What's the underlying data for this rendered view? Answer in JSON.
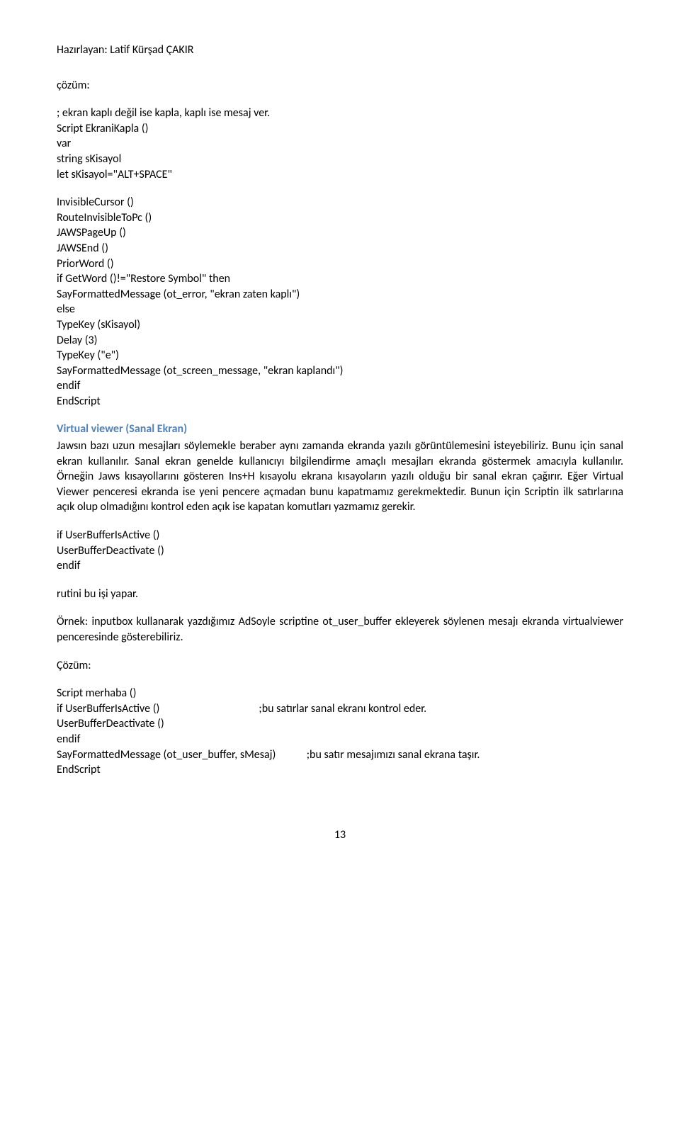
{
  "header": "Hazırlayan: Latif Kürşad ÇAKIR",
  "line_cozum_lower": "çözüm:",
  "comment1": "; ekran kaplı değil ise kapla, kaplı ise mesaj ver.",
  "code1": {
    "l1": "Script EkraniKapla ()",
    "l2": "var",
    "l3": "string sKisayol",
    "l4": "let sKisayol=\"ALT+SPACE\""
  },
  "code2": {
    "l1": "InvisibleCursor ()",
    "l2": "RouteInvisibleToPc ()",
    "l3": "JAWSPageUp ()",
    "l4": "JAWSEnd ()",
    "l5": "PriorWord ()",
    "l6": "if GetWord ()!=\"Restore Symbol\" then",
    "l7": "SayFormattedMessage (ot_error, \"ekran zaten kaplı\")",
    "l8": "else",
    "l9": " TypeKey (sKisayol)",
    "l10": "Delay (3)",
    "l11": "TypeKey (\"e\")",
    "l12": "SayFormattedMessage (ot_screen_message, \"ekran kaplandı\")",
    "l13": "endif",
    "l14": "EndScript"
  },
  "section_title": "Virtual viewer (Sanal Ekran)",
  "section_body": "Jawsın bazı uzun mesajları söylemekle beraber aynı zamanda ekranda yazılı görüntülemesini isteyebiliriz. Bunu için sanal ekran kullanılır. Sanal ekran genelde kullanıcıyı bilgilendirme amaçlı mesajları ekranda göstermek amacıyla kullanılır. Örneğin Jaws kısayollarını gösteren Ins+H kısayolu ekrana kısayoların yazılı olduğu bir sanal ekran çağırır. Eğer Virtual Viewer penceresi ekranda ise yeni pencere açmadan bunu kapatmamız gerekmektedir. Bunun için Scriptin ilk satırlarına açık olup olmadığını kontrol eden açık ise kapatan komutları yazmamız gerekir.",
  "code3": {
    "l1": "if UserBufferIsActive ()",
    "l2": "UserBufferDeactivate ()",
    "l3": "endif"
  },
  "rutin": "rutini bu işi yapar.",
  "example": "Örnek: inputbox kullanarak yazdığımız AdSoyle scriptine ot_user_buffer ekleyerek söylenen mesajı ekranda virtualviewer penceresinde gösterebiliriz.",
  "cozum_upper": "Çözüm:",
  "code4": {
    "l1": "Script merhaba ()",
    "l2a": "if UserBufferIsActive ()",
    "l2b": ";bu satırlar sanal ekranı kontrol eder.",
    "l3": "UserBufferDeactivate ()",
    "l4": "endif",
    "l5a": "SayFormattedMessage (ot_user_buffer, sMesaj)",
    "l5b": ";bu satır mesajımızı sanal ekrana taşır.",
    "l6": "EndScript"
  },
  "page_number": "13"
}
